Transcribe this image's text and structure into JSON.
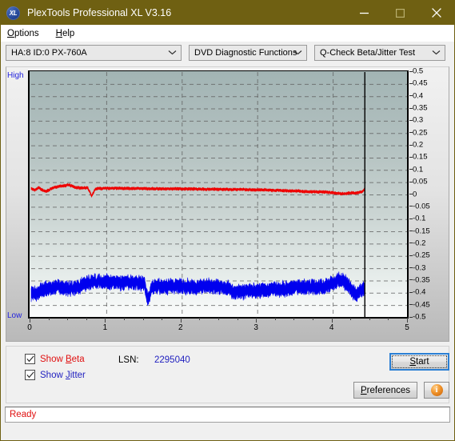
{
  "window": {
    "title": "PlexTools Professional XL V3.16",
    "icon_label": "XL",
    "accent_titlebar": "#6f6012",
    "minimize": "minimize-icon",
    "maximize": "maximize-icon",
    "close": "close-icon"
  },
  "menubar": {
    "items": [
      {
        "label": "Options",
        "mnemonic": "O"
      },
      {
        "label": "Help",
        "mnemonic": "H"
      }
    ]
  },
  "toolbar": {
    "drive_select": "HA:8 ID:0  PX-760A",
    "function_select": "DVD Diagnostic Functions",
    "test_select": "Q-Check Beta/Jitter Test"
  },
  "controls": {
    "show_beta": {
      "label": "Show Beta",
      "checked": true,
      "color": "#e01010"
    },
    "show_jitter": {
      "label": "Show Jitter",
      "checked": true,
      "color": "#1f1fbf"
    },
    "lsn_label": "LSN:",
    "lsn_value": "2295040",
    "start_button": "Start",
    "preferences_button": "Preferences",
    "info_button": "i"
  },
  "statusbar": {
    "text": "Ready"
  },
  "chart_data": {
    "type": "line",
    "title": "Q-Check Beta/Jitter Test",
    "xlabel": "",
    "ylabel": "",
    "xlim": [
      0,
      5
    ],
    "ylim": [
      -0.5,
      0.5
    ],
    "xticks": [
      0,
      1,
      2,
      3,
      4,
      5
    ],
    "xtick_labels": [
      "0",
      "1",
      "2",
      "3",
      "4",
      "5"
    ],
    "yticks": [
      0.5,
      0.45,
      0.4,
      0.35,
      0.3,
      0.25,
      0.2,
      0.15,
      0.1,
      0.05,
      0,
      -0.05,
      -0.1,
      -0.15,
      -0.2,
      -0.25,
      -0.3,
      -0.35,
      -0.4,
      -0.45,
      -0.5
    ],
    "ytick_labels": [
      "0.5",
      "0.45",
      "0.4",
      "0.35",
      "0.3",
      "0.25",
      "0.2",
      "0.15",
      "0.1",
      "0.05",
      "0",
      "-0.05",
      "-0.1",
      "-0.15",
      "-0.2",
      "-0.25",
      "-0.3",
      "-0.35",
      "-0.4",
      "-0.45",
      "-0.5"
    ],
    "axis_top_label": "High",
    "axis_bottom_label": "Low",
    "grid": true,
    "grid_style": "dashed",
    "data_end_marker_x": 4.42,
    "series": [
      {
        "name": "Beta",
        "color": "#ee0000",
        "x": [
          0.0,
          0.05,
          0.1,
          0.15,
          0.2,
          0.25,
          0.3,
          0.35,
          0.4,
          0.45,
          0.5,
          0.55,
          0.6,
          0.65,
          0.7,
          0.75,
          0.8,
          0.85,
          0.9,
          0.95,
          1.0,
          1.1,
          1.2,
          1.3,
          1.4,
          1.5,
          1.6,
          1.7,
          1.8,
          1.9,
          2.0,
          2.1,
          2.2,
          2.3,
          2.4,
          2.5,
          2.6,
          2.7,
          2.8,
          2.9,
          3.0,
          3.1,
          3.2,
          3.3,
          3.4,
          3.5,
          3.6,
          3.7,
          3.8,
          3.9,
          4.0,
          4.05,
          4.1,
          4.15,
          4.2,
          4.25,
          4.3,
          4.35,
          4.4,
          4.42
        ],
        "y": [
          0.025,
          0.02,
          0.03,
          0.018,
          0.015,
          0.022,
          0.03,
          0.033,
          0.036,
          0.038,
          0.042,
          0.034,
          0.03,
          0.028,
          0.029,
          0.028,
          -0.004,
          0.024,
          0.026,
          0.026,
          0.027,
          0.027,
          0.026,
          0.026,
          0.026,
          0.026,
          0.025,
          0.025,
          0.025,
          0.025,
          0.024,
          0.024,
          0.024,
          0.023,
          0.023,
          0.023,
          0.022,
          0.022,
          0.022,
          0.021,
          0.021,
          0.02,
          0.019,
          0.018,
          0.017,
          0.016,
          0.014,
          0.013,
          0.012,
          0.012,
          0.008,
          0.006,
          0.005,
          0.006,
          0.007,
          0.008,
          0.008,
          0.01,
          0.016,
          0.028
        ],
        "noise": 0.006
      },
      {
        "name": "Jitter",
        "color": "#0000ee",
        "x": [
          0.0,
          0.05,
          0.1,
          0.15,
          0.2,
          0.25,
          0.3,
          0.35,
          0.4,
          0.45,
          0.5,
          0.55,
          0.6,
          0.65,
          0.7,
          0.72,
          0.75,
          0.8,
          0.85,
          0.9,
          0.95,
          1.0,
          1.1,
          1.2,
          1.3,
          1.4,
          1.5,
          1.55,
          1.6,
          1.7,
          1.8,
          1.9,
          2.0,
          2.1,
          2.2,
          2.3,
          2.4,
          2.5,
          2.6,
          2.7,
          2.8,
          2.9,
          3.0,
          3.1,
          3.2,
          3.3,
          3.4,
          3.5,
          3.6,
          3.7,
          3.8,
          3.9,
          4.0,
          4.05,
          4.1,
          4.15,
          4.2,
          4.25,
          4.3,
          4.35,
          4.4,
          4.42
        ],
        "y": [
          -0.4,
          -0.402,
          -0.398,
          -0.39,
          -0.382,
          -0.378,
          -0.376,
          -0.372,
          -0.374,
          -0.378,
          -0.38,
          -0.378,
          -0.376,
          -0.374,
          -0.36,
          -0.358,
          -0.356,
          -0.354,
          -0.352,
          -0.354,
          -0.356,
          -0.354,
          -0.356,
          -0.358,
          -0.356,
          -0.358,
          -0.362,
          -0.432,
          -0.378,
          -0.372,
          -0.374,
          -0.37,
          -0.372,
          -0.374,
          -0.376,
          -0.372,
          -0.37,
          -0.374,
          -0.38,
          -0.398,
          -0.396,
          -0.392,
          -0.39,
          -0.388,
          -0.386,
          -0.384,
          -0.38,
          -0.376,
          -0.374,
          -0.376,
          -0.378,
          -0.372,
          -0.358,
          -0.35,
          -0.348,
          -0.352,
          -0.364,
          -0.39,
          -0.404,
          -0.392,
          -0.38,
          -0.386
        ],
        "noise": 0.03
      }
    ]
  }
}
